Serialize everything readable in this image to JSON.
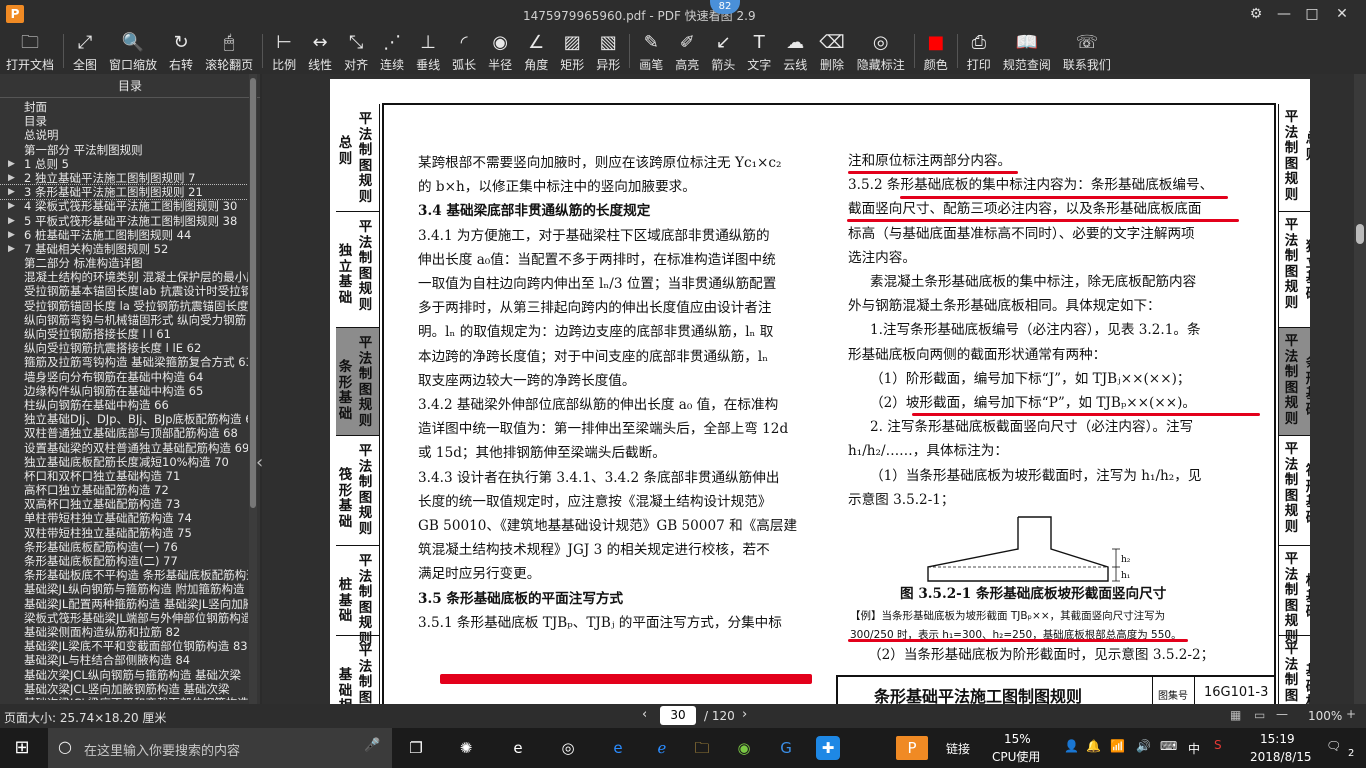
{
  "window": {
    "title": "1475979965960.pdf - PDF 快速看图 2.9",
    "update_badge": "82",
    "controls": [
      "⚙",
      "—",
      "□",
      "✕"
    ]
  },
  "toolbar": [
    {
      "label": "打开文档",
      "icon": "folder-icon",
      "glyph": "🗀"
    },
    {
      "label": "全图",
      "icon": "fit-all-icon",
      "glyph": "⤢"
    },
    {
      "label": "窗口缩放",
      "icon": "zoom-window-icon",
      "glyph": "🔍"
    },
    {
      "label": "右转",
      "icon": "rotate-right-icon",
      "glyph": "↻"
    },
    {
      "label": "滚轮翻页",
      "icon": "mouse-wheel-icon",
      "glyph": "🖱"
    },
    {
      "label": "比例",
      "icon": "scale-icon",
      "glyph": "⊢"
    },
    {
      "label": "线性",
      "icon": "linear-dim-icon",
      "glyph": "↔"
    },
    {
      "label": "对齐",
      "icon": "aligned-dim-icon",
      "glyph": "⤡"
    },
    {
      "label": "连续",
      "icon": "continuous-dim-icon",
      "glyph": "⋰"
    },
    {
      "label": "垂线",
      "icon": "perpendicular-icon",
      "glyph": "⊥"
    },
    {
      "label": "弧长",
      "icon": "arc-length-icon",
      "glyph": "◜"
    },
    {
      "label": "半径",
      "icon": "radius-icon",
      "glyph": "◉"
    },
    {
      "label": "角度",
      "icon": "angle-icon",
      "glyph": "∠"
    },
    {
      "label": "矩形",
      "icon": "rectangle-area-icon",
      "glyph": "▨"
    },
    {
      "label": "异形",
      "icon": "irregular-area-icon",
      "glyph": "▧"
    },
    {
      "label": "画笔",
      "icon": "pen-icon",
      "glyph": "✎"
    },
    {
      "label": "高亮",
      "icon": "highlighter-icon",
      "glyph": "✐"
    },
    {
      "label": "箭头",
      "icon": "arrow-icon",
      "glyph": "↙"
    },
    {
      "label": "文字",
      "icon": "text-icon",
      "glyph": "T"
    },
    {
      "label": "云线",
      "icon": "cloud-line-icon",
      "glyph": "☁"
    },
    {
      "label": "删除",
      "icon": "eraser-icon",
      "glyph": "⌫"
    },
    {
      "label": "隐藏标注",
      "icon": "hide-annotation-icon",
      "glyph": "◎"
    },
    {
      "label": "颜色",
      "icon": "color-swatch-icon",
      "glyph": "■",
      "red": true
    },
    {
      "label": "打印",
      "icon": "printer-icon",
      "glyph": "⎙"
    },
    {
      "label": "规范查阅",
      "icon": "book-icon",
      "glyph": "📖"
    },
    {
      "label": "联系我们",
      "icon": "contact-icon",
      "glyph": "☏"
    }
  ],
  "sidebar": {
    "title": "目录",
    "items": [
      {
        "label": "封面"
      },
      {
        "label": "目录"
      },
      {
        "label": "总说明"
      },
      {
        "label": "第一部分  平法制图规则"
      },
      {
        "label": "1 总则 5",
        "arrow": true
      },
      {
        "label": "2 独立基础平法施工图制图规则 7",
        "arrow": true
      },
      {
        "label": "3 条形基础平法施工图制图规则 21",
        "arrow": true,
        "selected": true
      },
      {
        "label": "4 梁板式筏形基础平法施工图制图规则 30",
        "arrow": true
      },
      {
        "label": "5 平板式筏形基础平法施工图制图规则 38",
        "arrow": true
      },
      {
        "label": "6 桩基础平法施工图制图规则 44",
        "arrow": true
      },
      {
        "label": "7 基础相关构造制图规则 52",
        "arrow": true
      },
      {
        "label": "第二部分  标准构造详图"
      },
      {
        "label": "混凝土结构的环境类别 混凝土保护层的最小厚度"
      },
      {
        "label": "受拉钢筋基本锚固长度lab 抗震设计时受拉钢筋"
      },
      {
        "label": "受拉钢筋锚固长度 la 受拉钢筋抗震锚固长度"
      },
      {
        "label": "纵向钢筋弯钩与机械锚固形式 纵向受力钢筋"
      },
      {
        "label": "纵向受拉钢筋搭接长度 l l  61"
      },
      {
        "label": "纵向受拉钢筋抗震搭接长度 l lE  62"
      },
      {
        "label": "箍筋及拉筋弯钩构造 基础梁箍筋复合方式 63"
      },
      {
        "label": "墙身竖向分布钢筋在基础中构造 64"
      },
      {
        "label": "边缘构件纵向钢筋在基础中构造 65"
      },
      {
        "label": "柱纵向钢筋在基础中构造 66"
      },
      {
        "label": "独立基础DJj、DJp、BJj、BJp底板配筋构造 67"
      },
      {
        "label": "双柱普通独立基础底部与顶部配筋构造 68"
      },
      {
        "label": "设置基础梁的双柱普通独立基础配筋构造 69"
      },
      {
        "label": "独立基础底板配筋长度减短10%构造 70"
      },
      {
        "label": "杯口和双杯口独立基础构造 71"
      },
      {
        "label": "高杯口独立基础配筋构造 72"
      },
      {
        "label": "双高杯口独立基础配筋构造 73"
      },
      {
        "label": "单柱带短柱独立基础配筋构造 74"
      },
      {
        "label": "双柱带短柱独立基础配筋构造 75"
      },
      {
        "label": "条形基础底板配筋构造(一) 76"
      },
      {
        "label": "条形基础底板配筋构造(二) 77"
      },
      {
        "label": "条形基础板底不平构造 条形基础底板配筋构造"
      },
      {
        "label": "基础梁JL纵向钢筋与箍筋构造 附加箍筋构造"
      },
      {
        "label": "基础梁JL配置两种箍筋构造 基础梁JL竖向加腋"
      },
      {
        "label": "梁板式筏形基础梁JL端部与外伸部位钢筋构造"
      },
      {
        "label": "基础梁侧面构造纵筋和拉筋 82"
      },
      {
        "label": "基础梁JL梁底不平和变截面部位钢筋构造 83"
      },
      {
        "label": "基础梁JL与柱结合部侧腋构造 84"
      },
      {
        "label": "基础次梁JCL纵向钢筋与箍筋构造 基础次梁"
      },
      {
        "label": "基础次梁JCL竖向加腋钢筋构造 基础次梁"
      },
      {
        "label": "基础次梁JCL梁底不平和变截面部位钢筋构造"
      }
    ]
  },
  "page": {
    "left_tabs": [
      {
        "col1": "总则",
        "col2": "平法制图规则"
      },
      {
        "col1": "独立基础",
        "col2": "平法制图规则"
      },
      {
        "col1": "条形基础",
        "col2": "平法制图规则",
        "active": true
      },
      {
        "col1": "筏形基础",
        "col2": "平法制图规则"
      },
      {
        "col1": "桩基础",
        "col2": "平法制图规则"
      },
      {
        "col1": "基础相关",
        "col2": "平法制图"
      }
    ],
    "right_tabs": [
      {
        "col1": "平法制图规则",
        "col2": "总则"
      },
      {
        "col1": "平法制图规则",
        "col2": "独立基础"
      },
      {
        "col1": "平法制图规则",
        "col2": "条形基础",
        "active": true
      },
      {
        "col1": "平法制图规则",
        "col2": "筏形基础"
      },
      {
        "col1": "平法制图规则",
        "col2": "桩基础"
      },
      {
        "col1": "平法制图",
        "col2": "基础相关"
      }
    ],
    "left_col": [
      "某跨根部不需要竖向加腋时，则应在该跨原位标注无 Yc₁×c₂",
      "的 b×h，以修正集中标注中的竖向加腋要求。",
      "3.4  基础梁底部非贯通纵筋的长度规定",
      "3.4.1  为方便施工，对于基础梁柱下区域底部非贯通纵筋的",
      "伸出长度 a₀值：当配置不多于两排时，在标准构造详图中统",
      "一取值为自柱边向跨内伸出至 lₙ/3 位置；当非贯通纵筋配置",
      "多于两排时，从第三排起向跨内的伸出长度值应由设计者注",
      "明。lₙ 的取值规定为：边跨边支座的底部非贯通纵筋，lₙ 取",
      "本边跨的净跨长度值；对于中间支座的底部非贯通纵筋，lₙ",
      "取支座两边较大一跨的净跨长度值。",
      "3.4.2  基础梁外伸部位底部纵筋的伸出长度 a₀ 值，在标准构",
      "造详图中统一取值为：第一排伸出至梁端头后，全部上弯 12d",
      "或 15d；其他排钢筋伸至梁端头后截断。",
      "3.4.3  设计者在执行第 3.4.1、3.4.2 条底部非贯通纵筋伸出",
      "长度的统一取值规定时，应注意按《混凝土结构设计规范》",
      "GB 50010、《建筑地基基础设计规范》GB 50007 和《高层建",
      "筑混凝土结构技术规程》JGJ 3 的相关规定进行校核，若不",
      "满足时应另行变更。",
      "3.5  条形基础底板的平面注写方式",
      "3.5.1  条形基础底板 TJBₚ、TJBⱼ 的平面注写方式，分集中标"
    ],
    "right_col": [
      "注和原位标注两部分内容。",
      "3.5.2  条形基础底板的集中标注内容为：条形基础底板编号、",
      "截面竖向尺寸、配筋三项必注内容，以及条形基础底板底面",
      "标高（与基础底面基准标高不同时）、必要的文字注解两项",
      "选注内容。",
      "素混凝土条形基础底板的集中标注，除无底板配筋内容",
      "外与钢筋混凝土条形基础底板相同。具体规定如下：",
      "1.注写条形基础底板编号（必注内容），见表 3.2.1。条",
      "形基础底板向两侧的截面形状通常有两种：",
      "（1）阶形截面，编号加下标“J”，如 TJBⱼ××(××)；",
      "（2）坡形截面，编号加下标“P”，如 TJBₚ××(××)。",
      "2. 注写条形基础底板截面竖向尺寸（必注内容）。注写",
      "h₁/h₂/……，具体标注为：",
      "（1）当条形基础底板为坡形截面时，注写为 h₁/h₂，见",
      "示意图 3.5.2-1；"
    ],
    "figure_caption": "图 3.5.2-1  条形基础底板坡形截面竖向尺寸",
    "example_line1": "【例】当条形基础底板为坡形截面 TJBₚ××，其截面竖向尺寸注写为",
    "example_line2": "300/250 时，表示 h₁=300、h₂=250，基础底板根部总高度为 550。",
    "next_line": "（2）当条形基础底板为阶形截面时，见示意图 3.5.2-2；",
    "fig_labels": [
      "h₁",
      "h₂"
    ],
    "bottom_title": "条形基础平法施工图制图规则",
    "bottom_atlas_label": "图集号",
    "bottom_atlas_no": "16G101-3"
  },
  "statusbar": {
    "page_size": "页面大小: 25.74×18.20 厘米",
    "current_page": "30",
    "total_pages": "/ 120",
    "zoom": "100%"
  },
  "taskbar": {
    "search_placeholder": "在这里输入你要搜索的内容",
    "cpu_percent": "15%",
    "cpu_label": "CPU使用",
    "link_label": "链接",
    "time": "15:19",
    "date": "2018/8/15",
    "ime": "中",
    "notif_count": "2"
  },
  "colors": {
    "annotation": "#e3001b",
    "active_tab": "#8c8c8c"
  }
}
